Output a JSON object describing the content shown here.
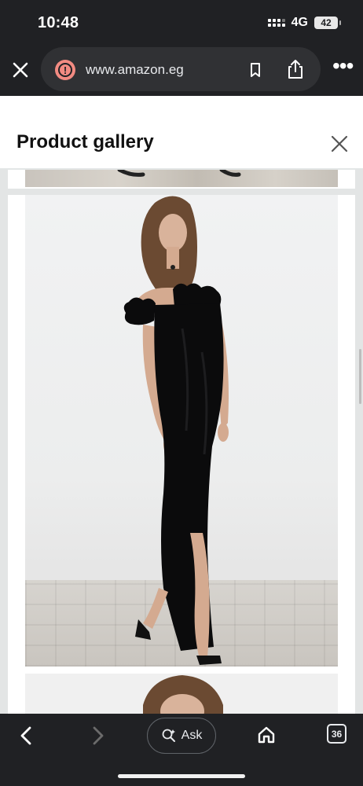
{
  "status": {
    "time": "10:48",
    "network": "4G",
    "battery": "42"
  },
  "browser": {
    "url": "www.amazon.eg",
    "site_status_icon": "warning-circle-icon",
    "actions": [
      "bookmark-icon",
      "share-icon",
      "more-menu-icon"
    ]
  },
  "gallery": {
    "title": "Product gallery",
    "close_icon": "close-icon",
    "images": [
      {
        "name": "gallery-image-previous",
        "description_visible": false
      },
      {
        "name": "gallery-image-black-offshoulder-maxi-dress",
        "description_visible": false
      },
      {
        "name": "gallery-image-next",
        "description_visible": false
      }
    ]
  },
  "toolbar": {
    "ask_label": "Ask",
    "tabs_count": "36"
  },
  "colors": {
    "chrome_bg": "#202124",
    "gallery_bg": "#e3e5e5",
    "warning": "#f28b82",
    "dress": "#0b0b0c"
  }
}
